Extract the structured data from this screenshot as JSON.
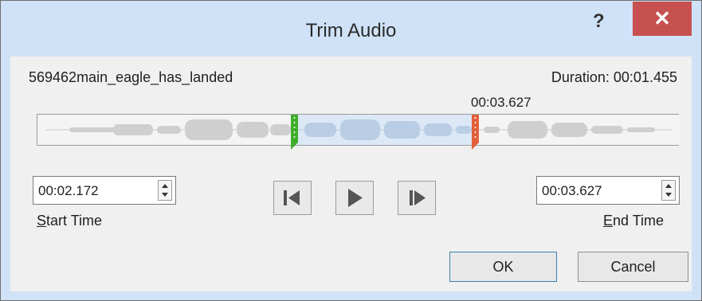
{
  "window": {
    "title": "Trim Audio",
    "help_label": "?",
    "close_label": "✕"
  },
  "file": {
    "name": "569462main_eagle_has_landed",
    "duration_label": "Duration: 00:01.455"
  },
  "timeline": {
    "end_marker_time": "00:03.627"
  },
  "start": {
    "value": "00:02.172",
    "label_accel": "S",
    "label_rest": "tart Time"
  },
  "end": {
    "value": "00:03.627",
    "label_accel": "E",
    "label_rest": "nd Time"
  },
  "transport": {
    "prev_icon": "previous-frame-icon",
    "play_icon": "play-icon",
    "next_icon": "next-frame-icon"
  },
  "buttons": {
    "ok": "OK",
    "cancel": "Cancel"
  },
  "colors": {
    "start_marker": "#3fae2a",
    "end_marker": "#e2603b",
    "selection": "#dce8f6",
    "title_bg": "#cfe2f7",
    "close_bg": "#c75050"
  }
}
